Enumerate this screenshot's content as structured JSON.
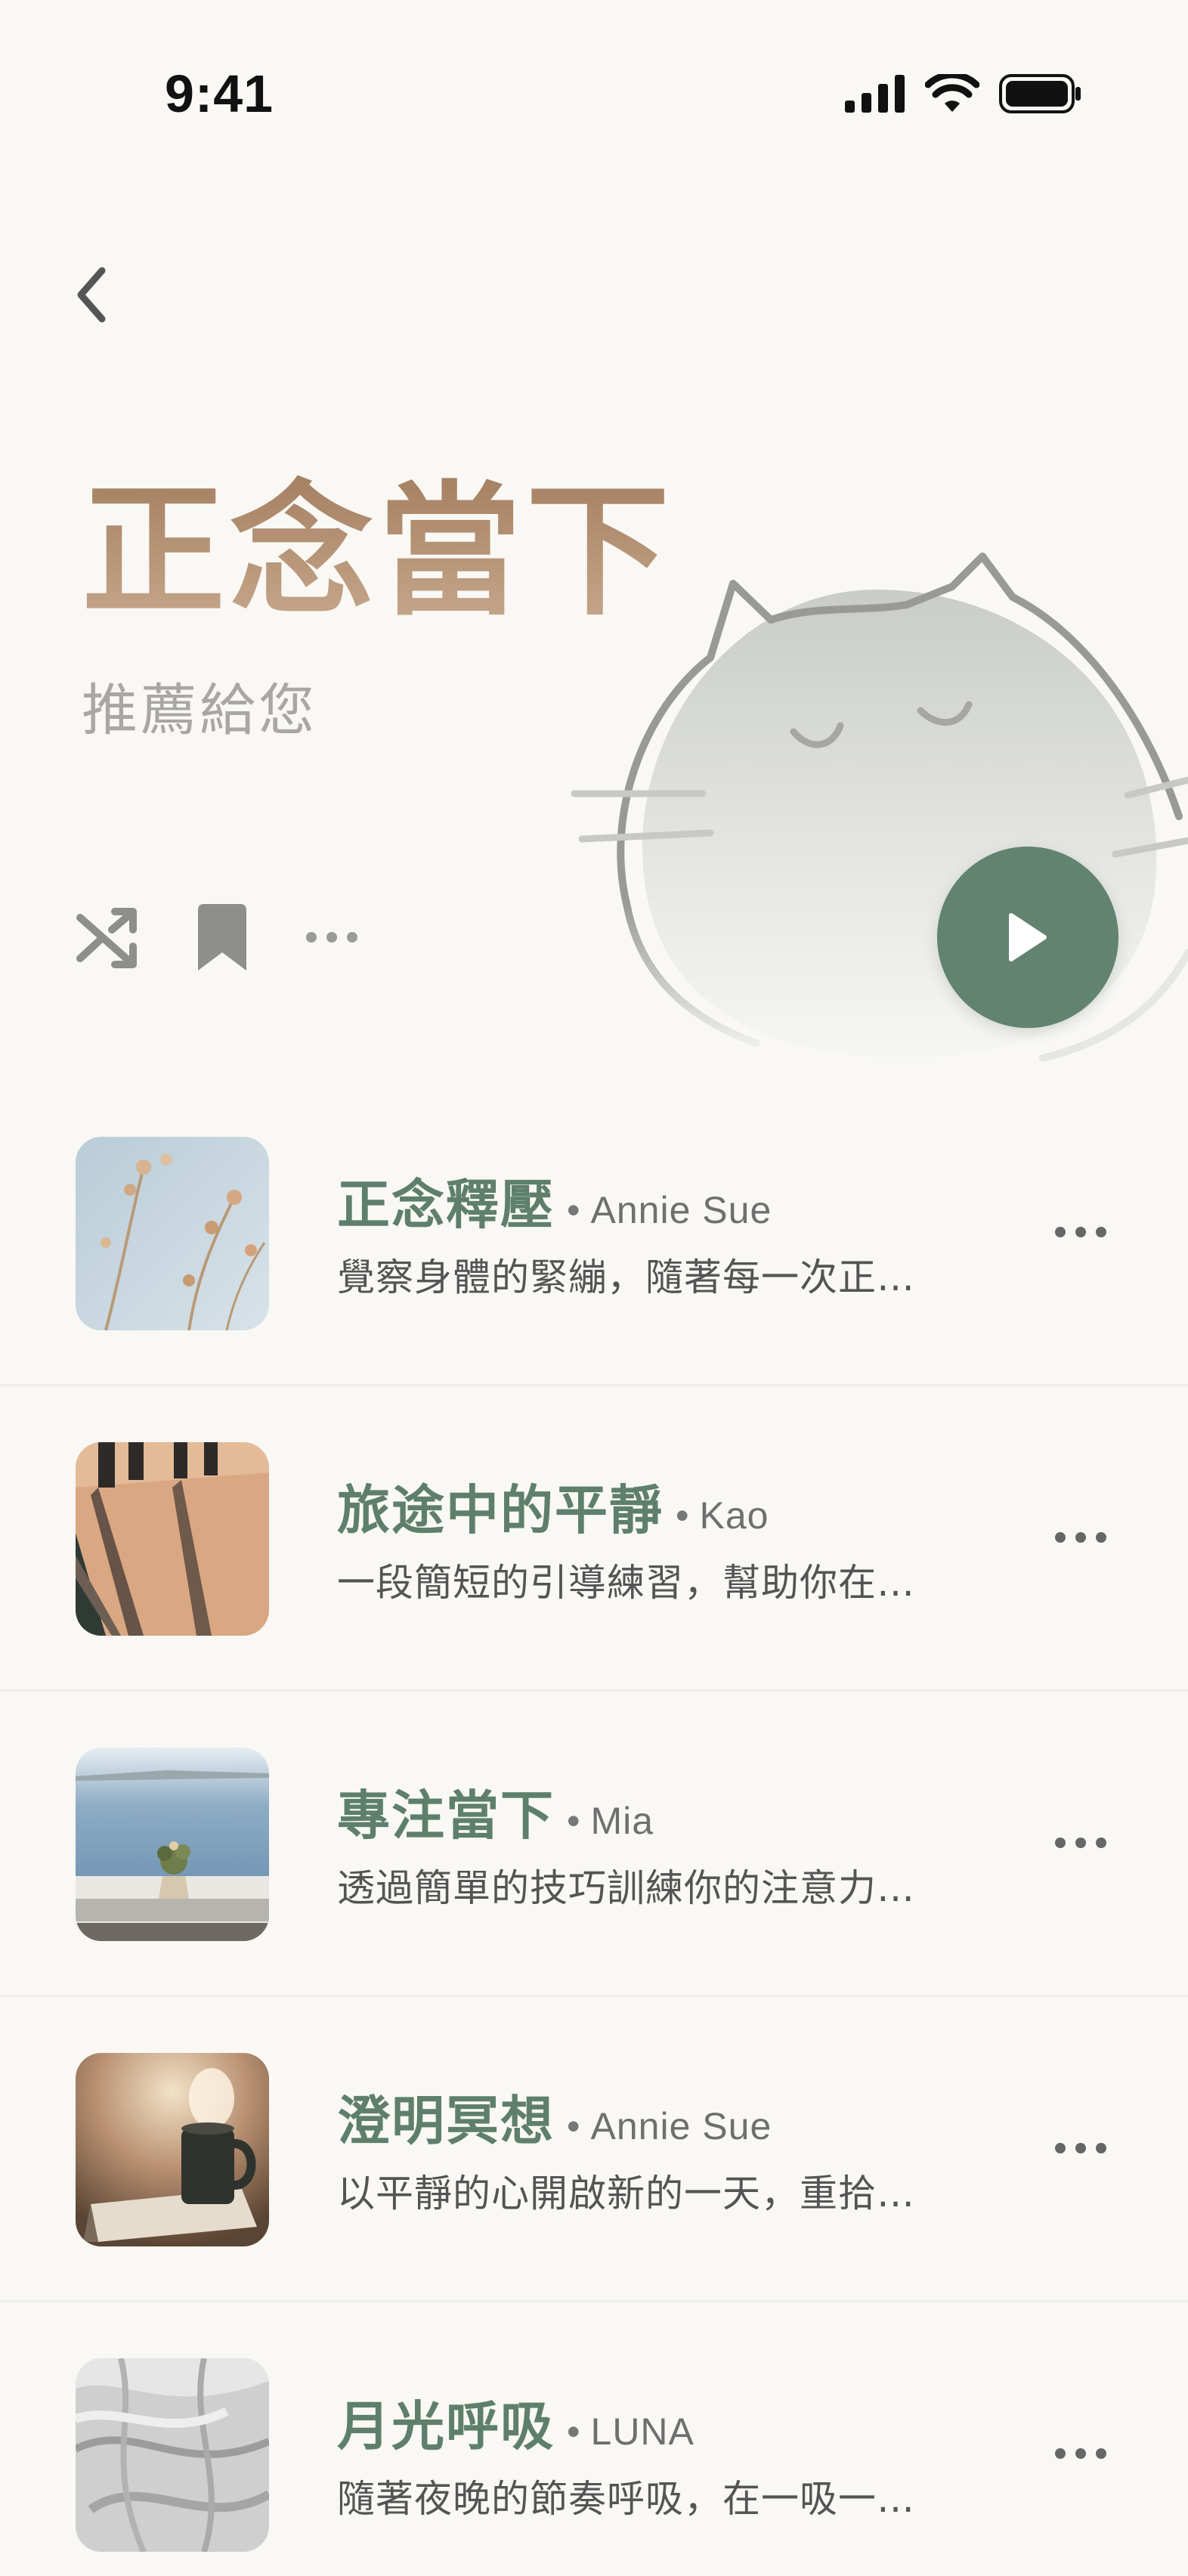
{
  "status_bar": {
    "time": "9:41"
  },
  "header": {
    "back_icon": "chevron-left-icon"
  },
  "hero": {
    "title": "正念當下",
    "subtitle": "推薦給您",
    "illustration": "sleeping-cat-illustration"
  },
  "actions": {
    "shuffle_icon": "shuffle-icon",
    "bookmark_icon": "bookmark-icon",
    "more_icon": "more-horizontal-icon",
    "play_icon": "play-icon"
  },
  "colors": {
    "accent_green": "#62836f",
    "title_brown": "#b38c6c",
    "track_title": "#5e7f6c",
    "background": "#f9f8f4"
  },
  "tracks": [
    {
      "title": "正念釋壓",
      "author": "Annie Sue",
      "description": "覺察身體的緊繃，隨著每一次正…",
      "thumbnail": "dried-flowers-photo"
    },
    {
      "title": "旅途中的平靜",
      "author": "Kao",
      "description": "一段簡短的引導練習，幫助你在…",
      "thumbnail": "people-walking-shadows-photo"
    },
    {
      "title": "專注當下",
      "author": "Mia",
      "description": "透過簡單的技巧訓練你的注意力…",
      "thumbnail": "sea-view-plant-photo"
    },
    {
      "title": "澄明冥想",
      "author": "Annie Sue",
      "description": "以平靜的心開啟新的一天，重拾…",
      "thumbnail": "coffee-mug-book-photo"
    },
    {
      "title": "月光呼吸",
      "author": "LUNA",
      "description": "隨著夜晚的節奏呼吸，在一吸一…",
      "thumbnail": "white-sheets-photo"
    }
  ],
  "separator": "•"
}
